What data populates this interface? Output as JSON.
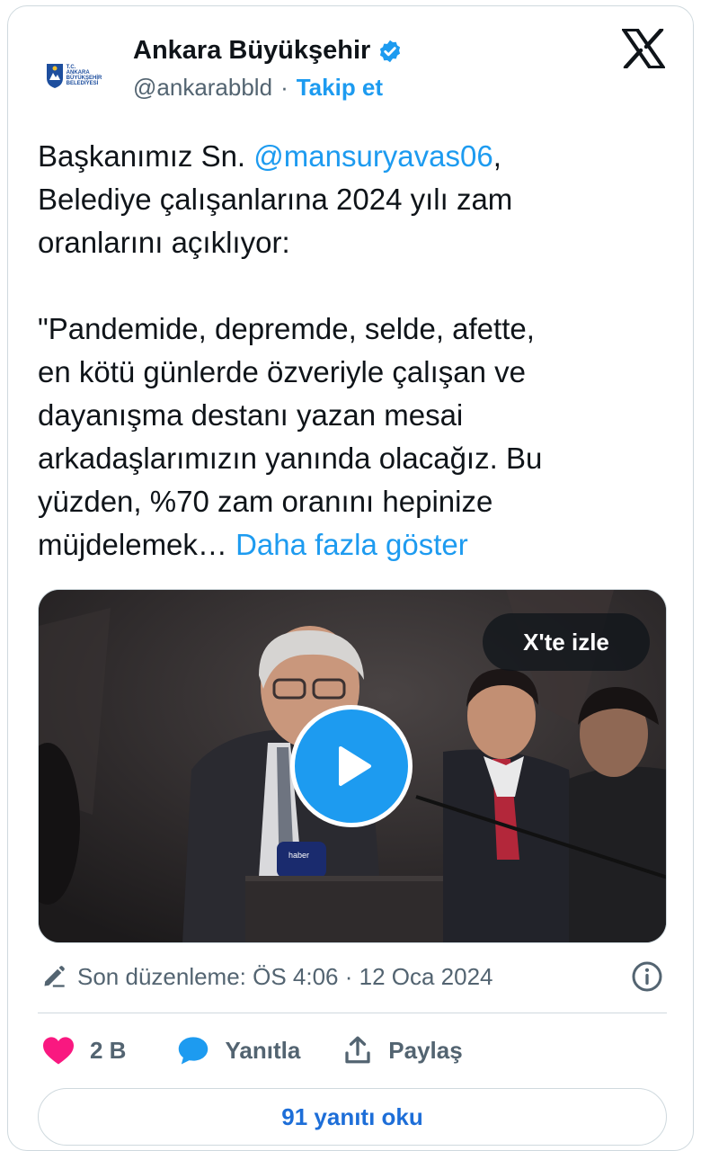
{
  "account": {
    "name": "Ankara Büyükşehir",
    "handle": "@ankarabbld",
    "separator": "·",
    "follow_label": "Takip et",
    "logo_text_1": "T.C.",
    "logo_text_2": "ANKARA",
    "logo_text_3": "BÜYÜKŞEHİR",
    "logo_text_4": "BELEDİYESİ"
  },
  "tweet": {
    "text_before_mention": "Başkanımız Sn. ",
    "mention": "@mansuryavas06",
    "text_after_mention": ",\nBelediye çalışanlarına 2024 yılı zam\noranlarını açıklıyor:\n\n\"Pandemide, depremde, selde, afette,\nen kötü günlerde özveriyle çalışan ve\ndayanışma destanı yazan mesai\narkadaşlarımızın yanında olacağız. Bu\nyüzden, %70 zam oranını hepinize\nmüjdelemek… ",
    "show_more": "Daha fazla göster"
  },
  "media": {
    "watch_label": "X'te izle",
    "mic_label": "haber"
  },
  "meta": {
    "edited_text": "Son düzenleme: ÖS 4:06 · 12 Oca 2024"
  },
  "actions": {
    "likes": "2 B",
    "reply_label": "Yanıtla",
    "share_label": "Paylaş"
  },
  "read_replies_label": "91 yanıtı oku",
  "colors": {
    "accent": "#1d9bf0",
    "like": "#f91880",
    "muted": "#536471",
    "border": "#cfd9de"
  },
  "icons": [
    "x-logo-icon",
    "verified-badge-icon",
    "play-icon",
    "pencil-edit-icon",
    "info-icon",
    "heart-icon",
    "reply-bubble-icon",
    "share-icon"
  ]
}
